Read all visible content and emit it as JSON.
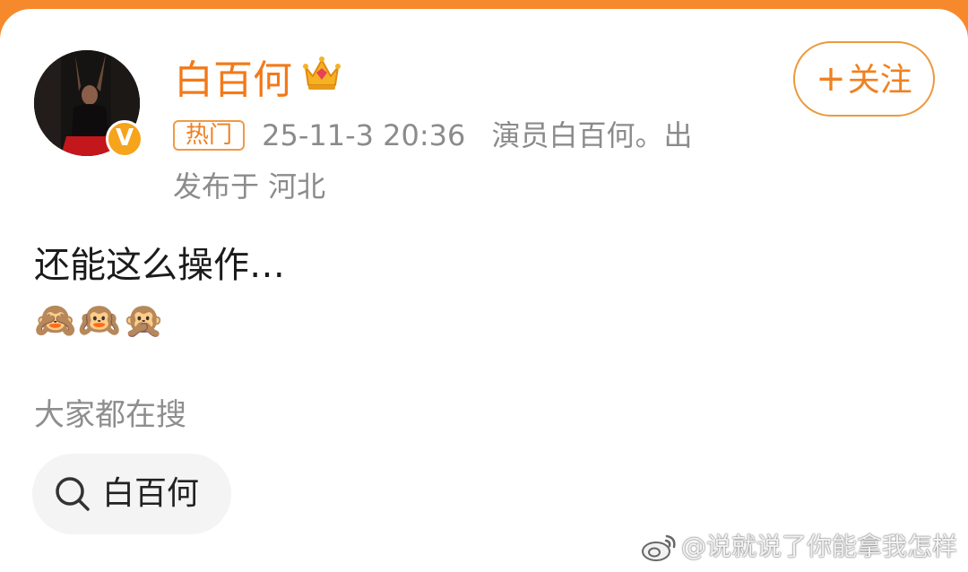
{
  "user": {
    "name": "白百何",
    "verified_mark": "V"
  },
  "follow_button": {
    "plus": "+",
    "label": "关注"
  },
  "post_meta": {
    "badge": "热门",
    "time": "25-11-3 20:36",
    "source": "演员白百何。出",
    "location": "发布于 河北"
  },
  "post": {
    "text": "还能这么操作…",
    "emojis": "🙈🙉🙊"
  },
  "trending": {
    "title": "大家都在搜",
    "search_term": "白百何"
  },
  "watermark": {
    "text": "@说就说了你能拿我怎样"
  },
  "colors": {
    "accent_orange": "#f27a1a",
    "top_bar": "#f7892d",
    "meta_gray": "#8b8b8b"
  },
  "icons": {
    "crown": "crown-icon",
    "search": "search-icon",
    "watermark_logo": "weibo-logo-icon"
  }
}
